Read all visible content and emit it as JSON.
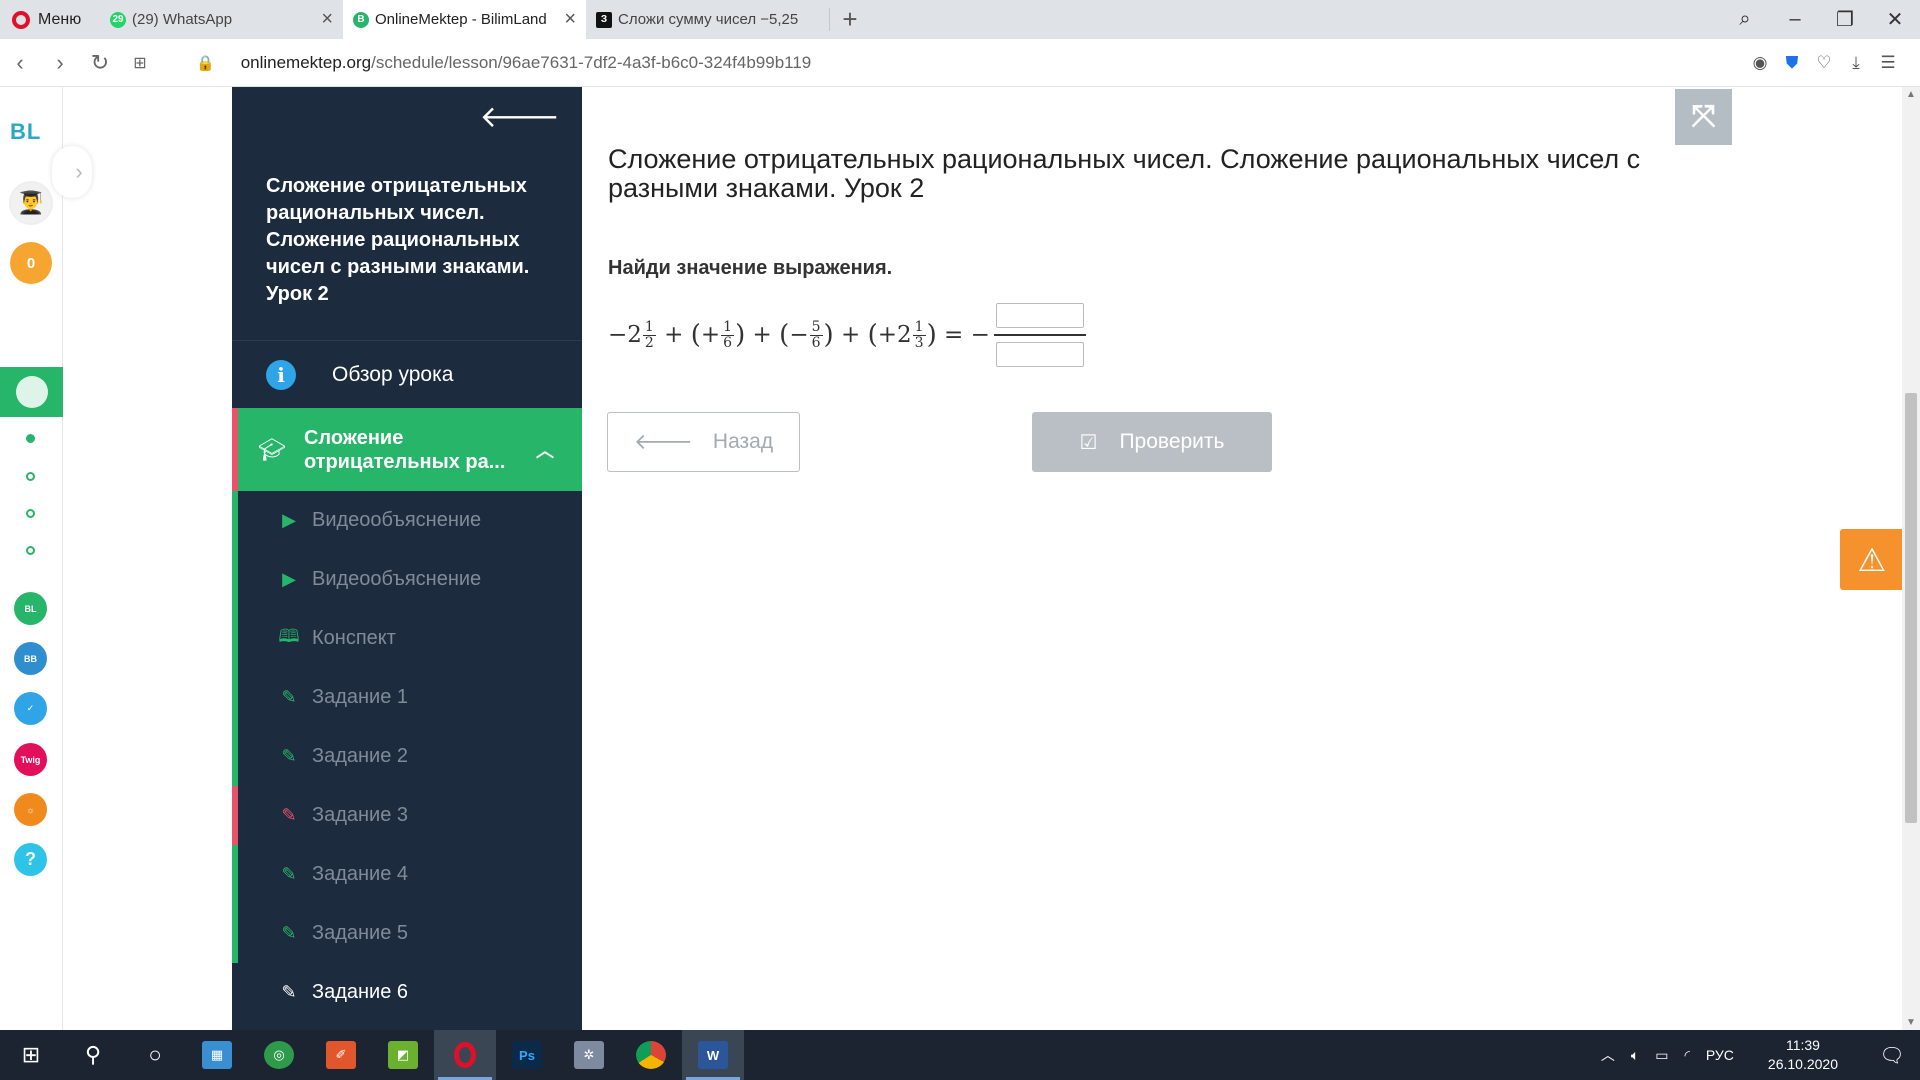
{
  "browser": {
    "menu_label": "Меню",
    "tabs": [
      {
        "title": "(29) WhatsApp",
        "badge": "29"
      },
      {
        "title": "OnlineMektep - BilimLand"
      },
      {
        "title": "Сложи сумму чисел −5,25"
      }
    ],
    "url_host": "onlinemektep.org",
    "url_path": "/schedule/lesson/96ae7631-7df2-4a3f-b6c0-324f4b99b119"
  },
  "rail": {
    "logo": "BL",
    "coins": "0",
    "help": "?"
  },
  "course": {
    "title": "Сложение отрицательных рациональных чисел. Сложение рациональных чисел с разными знаками. Урок 2",
    "overview_label": "Обзор урока",
    "section_label": "Сложение отрицательных ра...",
    "items": [
      {
        "label": "Видеообъяснение",
        "icon": "play-icon"
      },
      {
        "label": "Видеообъяснение",
        "icon": "play-icon"
      },
      {
        "label": "Конспект",
        "icon": "book-icon"
      },
      {
        "label": "Задание 1",
        "icon": "edit-icon"
      },
      {
        "label": "Задание 2",
        "icon": "edit-icon"
      },
      {
        "label": "Задание 3",
        "icon": "edit-icon",
        "status": "wrong"
      },
      {
        "label": "Задание 4",
        "icon": "edit-icon"
      },
      {
        "label": "Задание 5",
        "icon": "edit-icon"
      },
      {
        "label": "Задание 6",
        "icon": "edit-icon",
        "status": "current"
      }
    ]
  },
  "main": {
    "lesson_title": "Сложение отрицательных рациональных чисел. Сложение рациональных чисел с разными знаками. Урок 2",
    "task_question": "Найди значение выражения.",
    "expression": {
      "t1_sign": "−2",
      "t1_num": "1",
      "t1_den": "2",
      "t2_num": "1",
      "t2_den": "6",
      "t3_num": "5",
      "t3_den": "6",
      "t4_whole": "2",
      "t4_num": "1",
      "t4_den": "3",
      "answer_numerator": "",
      "answer_denominator": ""
    },
    "back_button": "Назад",
    "check_button": "Проверить"
  },
  "taskbar": {
    "language": "РУС",
    "time": "11:39",
    "date": "26.10.2020"
  },
  "colors": {
    "sidebar_bg": "#1c2b3e",
    "accent_green": "#27b56a",
    "error_red": "#e8536a",
    "warning_orange": "#f6922d"
  }
}
